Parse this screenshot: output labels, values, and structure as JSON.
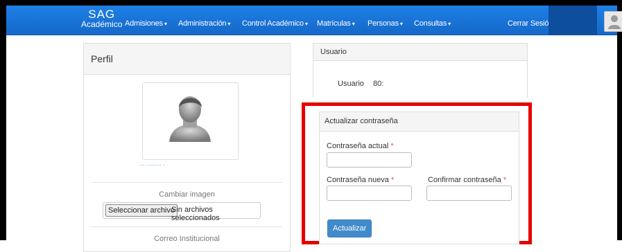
{
  "navbar": {
    "brand_top": "SAG",
    "brand_bottom": "Académico",
    "items": [
      {
        "label": "Admisiones"
      },
      {
        "label": "Administración"
      },
      {
        "label": "Control Académico"
      },
      {
        "label": "Matrículas"
      },
      {
        "label": "Personas"
      },
      {
        "label": "Consultas"
      }
    ],
    "caret": "▾",
    "logout": "Cerrar Sesió"
  },
  "profile": {
    "title": "Perfil",
    "name_link": "··· ········ ·",
    "change_image_label": "Cambiar imagen",
    "file_button": "Seleccionar archivo",
    "file_status": "Sin archivos seleccionados",
    "institutional_email_label": "Correo Institucional"
  },
  "user": {
    "title": "Usuario",
    "field_label": "Usuario",
    "field_value": "80:"
  },
  "password": {
    "title": "Actualizar contraseña",
    "current_label": "Contraseña actual",
    "new_label": "Contraseña nueva",
    "confirm_label": "Confirmar contraseña",
    "required_mark": "*",
    "submit": "Actualizar"
  },
  "colors": {
    "navbar": "#1e7fe6",
    "highlight": "#e60000",
    "primary_button": "#428bca"
  }
}
